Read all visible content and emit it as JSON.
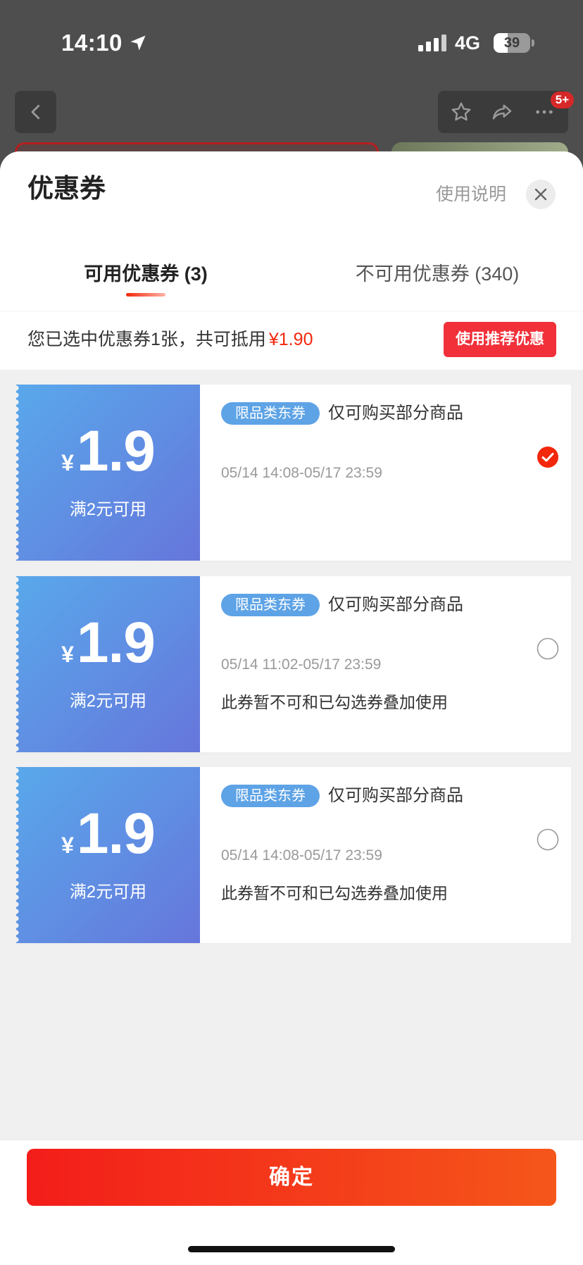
{
  "status_bar": {
    "time": "14:10",
    "network": "4G",
    "battery": "39",
    "icons": [
      "location-arrow-icon",
      "signal-icon",
      "battery-icon"
    ]
  },
  "nav": {
    "back_icon": "chevron-left-icon",
    "actions": [
      "star-icon",
      "share-icon",
      "more-icon"
    ],
    "more_badge": "5+"
  },
  "sheet": {
    "title": "优惠券",
    "help_link": "使用说明",
    "close_icon": "close-icon",
    "tabs": [
      {
        "label": "可用优惠券 (3)",
        "active": true
      },
      {
        "label": "不可用优惠券 (340)",
        "active": false
      }
    ],
    "summary": {
      "text": "您已选中优惠券1张，共可抵用",
      "amount": "¥1.90",
      "recommend_button": "使用推荐优惠"
    },
    "coupons": [
      {
        "currency": "¥",
        "amount": "1.9",
        "condition": "满2元可用",
        "tag": "限品类东券",
        "scope": "仅可购买部分商品",
        "validity": "05/14 14:08-05/17 23:59",
        "selected": true
      },
      {
        "currency": "¥",
        "amount": "1.9",
        "condition": "满2元可用",
        "tag": "限品类东券",
        "scope": "仅可购买部分商品",
        "validity": "05/14 11:02-05/17 23:59",
        "note": "此券暂不可和已勾选券叠加使用",
        "selected": false
      },
      {
        "currency": "¥",
        "amount": "1.9",
        "condition": "满2元可用",
        "tag": "限品类东券",
        "scope": "仅可购买部分商品",
        "validity": "05/14 14:08-05/17 23:59",
        "note": "此券暂不可和已勾选券叠加使用",
        "selected": false
      }
    ],
    "confirm_button": "确定"
  },
  "colors": {
    "accent_red": "#f2270c",
    "coupon_blue_start": "#59a8eb",
    "coupon_blue_end": "#6676db",
    "tag_blue": "#5ea3e6",
    "sheet_background": "#f0f0f0"
  }
}
